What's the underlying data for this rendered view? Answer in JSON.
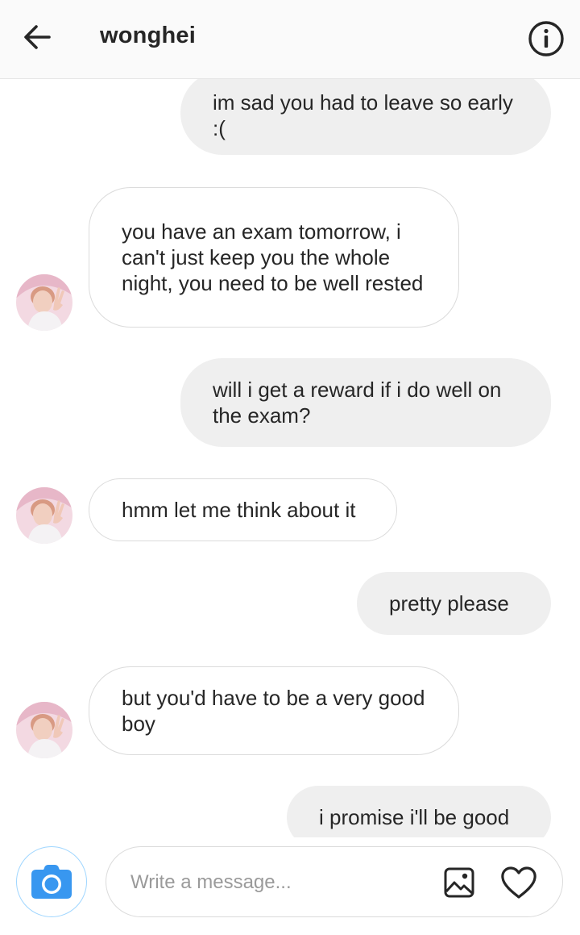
{
  "header": {
    "username": "wonghei",
    "back_icon": "arrow-left-icon",
    "info_icon": "info-circle-icon"
  },
  "contact": {
    "avatar_icon": "profile-photo"
  },
  "messages": [
    {
      "from": "me",
      "text": "im sad you had to leave so early :("
    },
    {
      "from": "them",
      "text": "you have an exam tomorrow, i can't just keep you the whole night, you need to be well rested"
    },
    {
      "from": "me",
      "text": "will i get a reward if i do well on the exam?"
    },
    {
      "from": "them",
      "text": "hmm let me think about it"
    },
    {
      "from": "me",
      "text": "pretty please"
    },
    {
      "from": "them",
      "text": "but you'd have to be a very good boy"
    },
    {
      "from": "me",
      "text": "i promise i'll be good"
    }
  ],
  "composer": {
    "placeholder": "Write a message...",
    "camera_icon": "camera-icon",
    "gallery_icon": "image-icon",
    "like_icon": "heart-icon"
  },
  "colors": {
    "sent_bubble": "#efefef",
    "received_border": "#dbdbdb",
    "camera_blue": "#3897f0",
    "text": "#262626"
  }
}
